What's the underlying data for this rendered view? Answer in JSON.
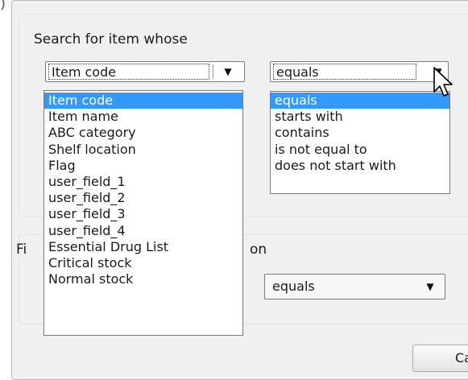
{
  "corner_text": ")",
  "search_group": {
    "title": "Search for item whose",
    "field_combo": {
      "value": "Item code"
    },
    "operator_combo": {
      "value": "equals"
    },
    "field_list": {
      "items": [
        "Item code",
        "Item name",
        "ABC category",
        "Shelf location",
        "Flag",
        "user_field_1",
        "user_field_2",
        "user_field_3",
        "user_field_4",
        "Essential Drug List",
        "Critical stock",
        "Normal stock"
      ],
      "selected_index": 0
    },
    "operator_list": {
      "items": [
        "equals",
        "starts with",
        "contains",
        "is not equal to",
        "does not start with"
      ],
      "selected_index": 0
    }
  },
  "second_group": {
    "title_left_fragment": "Fi",
    "title_right_fragment": "on",
    "operator_combo": {
      "value": "equals"
    }
  },
  "cancel_button_fragment": "Ca",
  "icons": {
    "dropdown_arrow": "▼",
    "cursor": "arrow-pointer"
  },
  "colors": {
    "selection": "#3399ff",
    "dialog_bg": "#f0f0f0"
  }
}
